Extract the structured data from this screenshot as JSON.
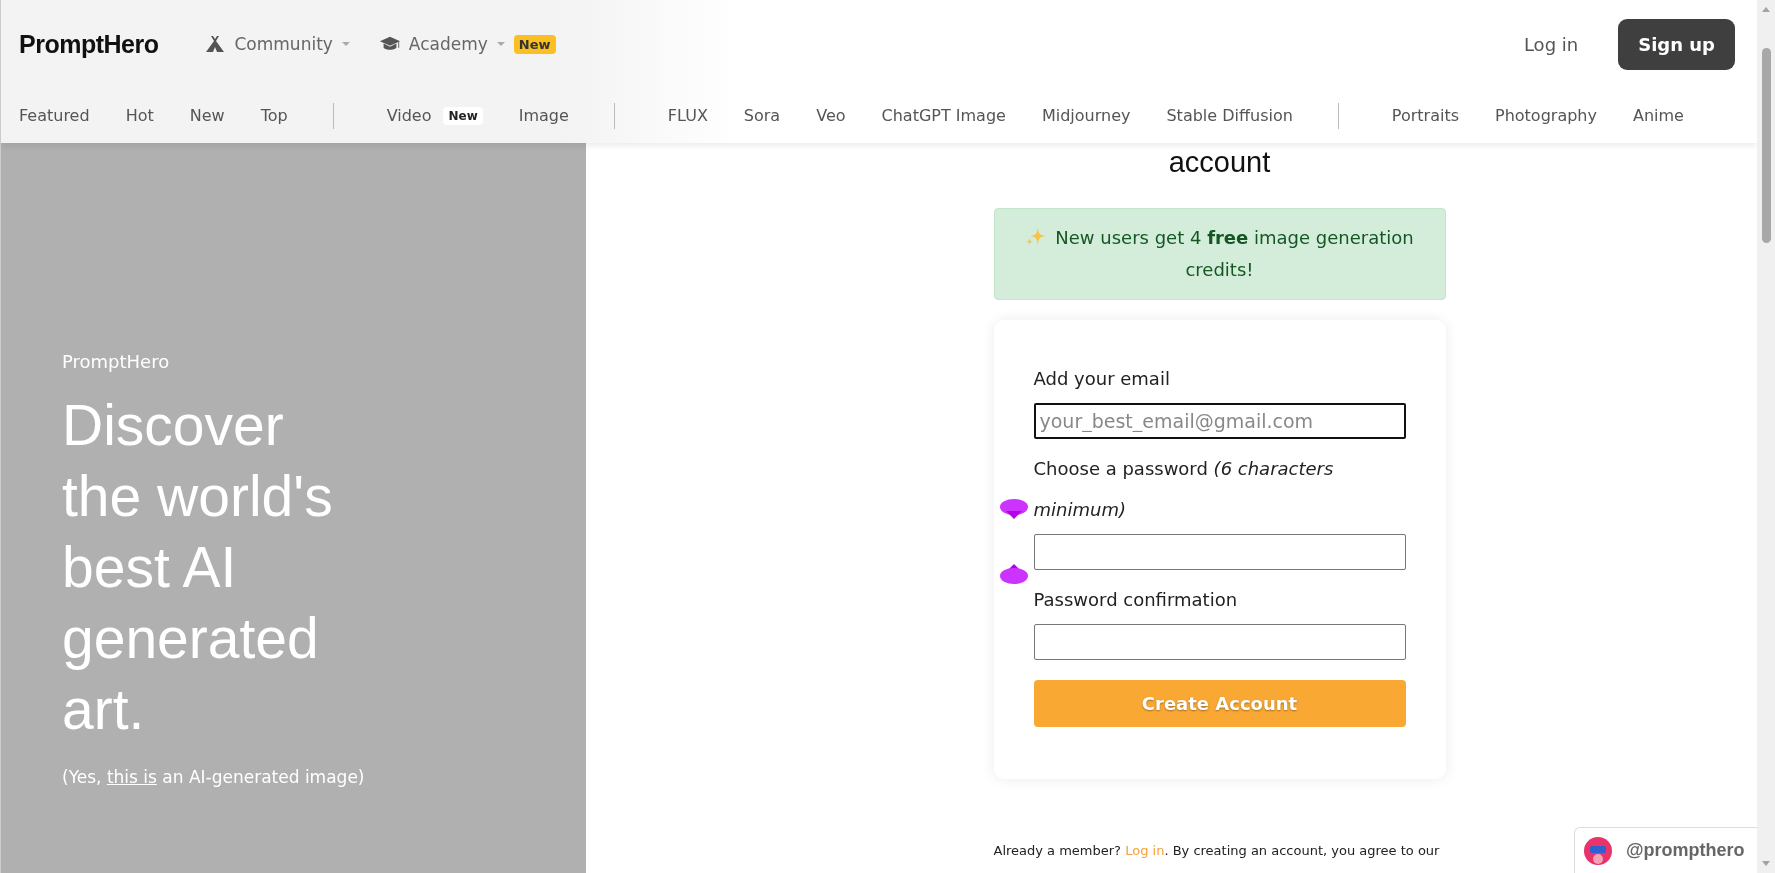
{
  "header": {
    "logo": "PromptHero",
    "menus": [
      {
        "kind": "tent",
        "label": "Community"
      },
      {
        "kind": "cap",
        "label": "Academy",
        "badge": "New"
      }
    ],
    "login": "Log in",
    "signup": "Sign up"
  },
  "nav": {
    "groups": [
      [
        {
          "label": "Featured"
        },
        {
          "label": "Hot"
        },
        {
          "label": "New"
        },
        {
          "label": "Top"
        }
      ],
      [
        {
          "label": "Video",
          "badge": "New"
        },
        {
          "label": "Image"
        }
      ],
      [
        {
          "label": "FLUX"
        },
        {
          "label": "Sora"
        },
        {
          "label": "Veo"
        },
        {
          "label": "ChatGPT Image"
        },
        {
          "label": "Midjourney"
        },
        {
          "label": "Stable Diffusion"
        }
      ],
      [
        {
          "label": "Portraits"
        },
        {
          "label": "Photography"
        },
        {
          "label": "Anime"
        }
      ]
    ]
  },
  "hero": {
    "brand": "PromptHero",
    "heading": "Discover the world's best AI generated art.",
    "caption": {
      "before": "(Yes, ",
      "link": "this is",
      "after": " an AI-generated image)"
    }
  },
  "form": {
    "title": "account",
    "notice": "New users get 4 **free** image generation credits!",
    "fields": [
      {
        "label": "Add your email",
        "placeholder": "your_best_email@gmail.com",
        "focused": true
      },
      {
        "label": "Choose a password *(6 characters minimum)*",
        "focused": false,
        "handles": true
      },
      {
        "label": "Password confirmation",
        "focused": false
      }
    ],
    "button": "Create Account"
  },
  "footer": {
    "before": "Already a member? ",
    "link": "Log in",
    "after": ". By creating an account, you agree to our"
  },
  "profile_badge": {
    "handle": "@prompthero"
  }
}
